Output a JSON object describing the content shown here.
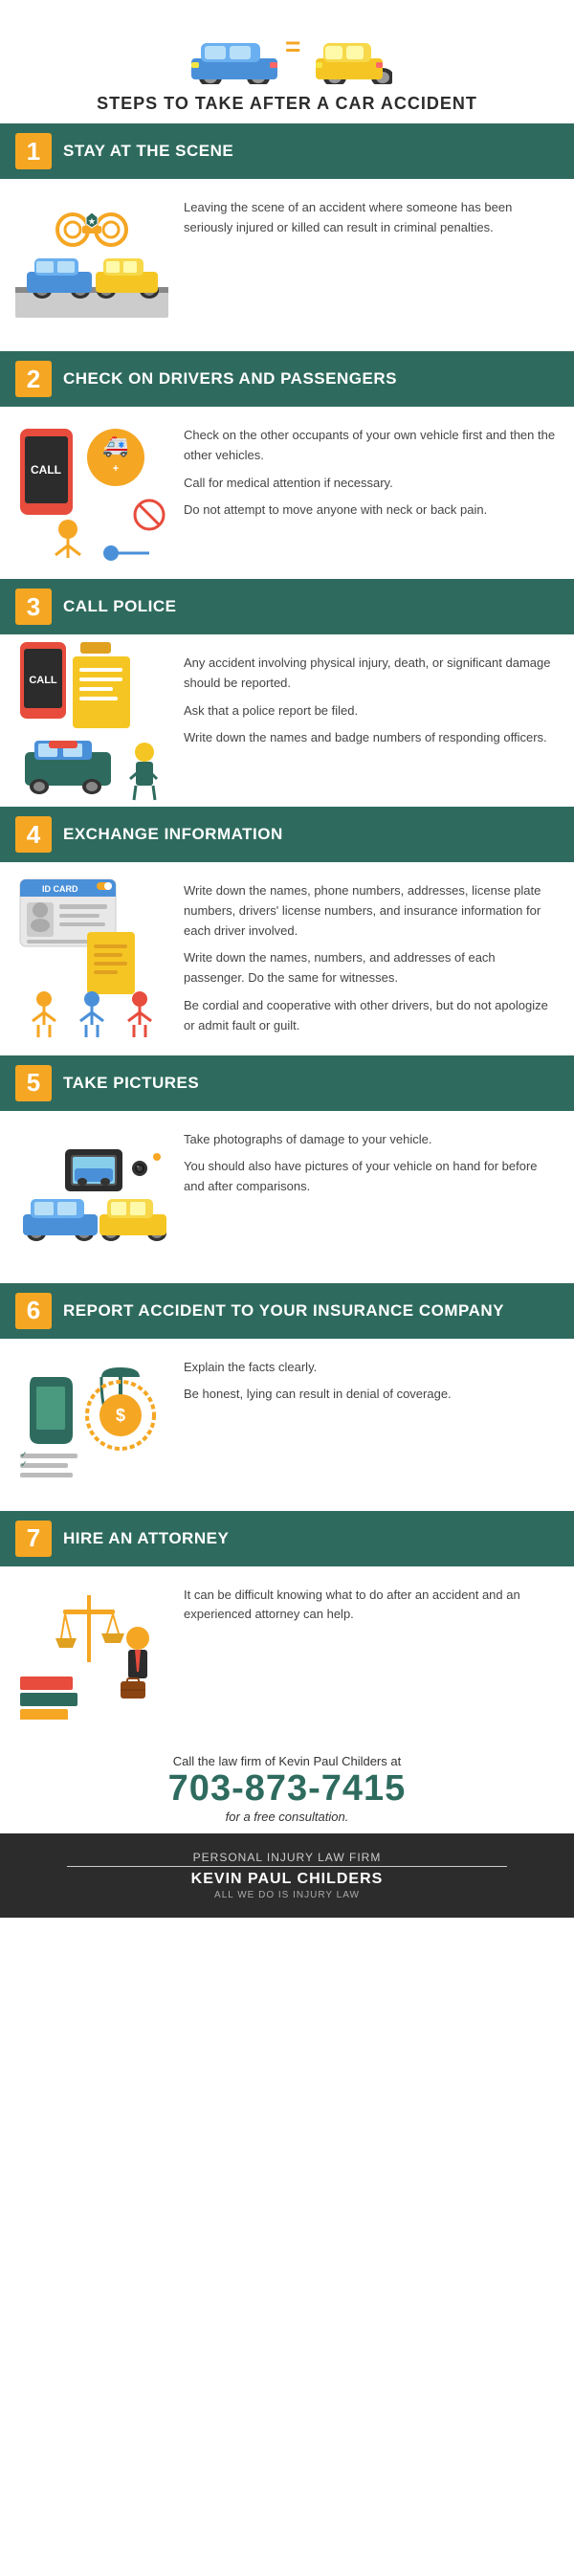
{
  "header": {
    "title": "STEPS TO TAKE AFTER A CAR ACCIDENT"
  },
  "steps": [
    {
      "number": "1",
      "title": "STAY AT THE SCENE",
      "text": [
        "Leaving the scene of an accident where someone has been seriously injured or killed can result in criminal penalties."
      ]
    },
    {
      "number": "2",
      "title": "CHECK ON DRIVERS AND PASSENGERS",
      "text": [
        "Check on the other occupants of your own vehicle first and then the other vehicles.",
        "Call for medical attention if necessary.",
        "Do not attempt to move anyone with neck or back pain."
      ]
    },
    {
      "number": "3",
      "title": "CALL POLICE",
      "text": [
        "Any accident involving physical injury, death, or significant damage should be reported.",
        "Ask that a police report be filed.",
        "Write down the names and badge numbers of responding officers."
      ]
    },
    {
      "number": "4",
      "title": "EXCHANGE INFORMATION",
      "text": [
        "Write down the names, phone numbers, addresses, license plate numbers, drivers' license numbers, and insurance information for each driver involved.",
        "Write down the names, numbers, and addresses of each passenger. Do the same for witnesses.",
        "Be cordial and cooperative with other drivers, but do not apologize or admit fault or guilt."
      ]
    },
    {
      "number": "5",
      "title": "TAKE PICTURES",
      "text": [
        "Take photographs of damage to your vehicle.",
        "You should also have pictures of your vehicle on hand for before and after comparisons."
      ]
    },
    {
      "number": "6",
      "title": "REPORT ACCIDENT TO YOUR INSURANCE COMPANY",
      "text": [
        "Explain the facts clearly.",
        "Be honest, lying can result in denial of coverage."
      ]
    },
    {
      "number": "7",
      "title": "HIRE AN ATTORNEY",
      "text": [
        "It can be difficult knowing what to do after an accident and an experienced attorney can help."
      ]
    }
  ],
  "cta": {
    "line1": "Call the law firm of Kevin Paul Childers at",
    "phone": "703-873-7415",
    "line2": "for a free consultation."
  },
  "footer": {
    "firm_label": "PERSONAL INJURY LAW FIRM",
    "attorney": "KEVIN PAUL CHILDERS",
    "tagline": "ALL WE DO IS INJURY LAW"
  }
}
